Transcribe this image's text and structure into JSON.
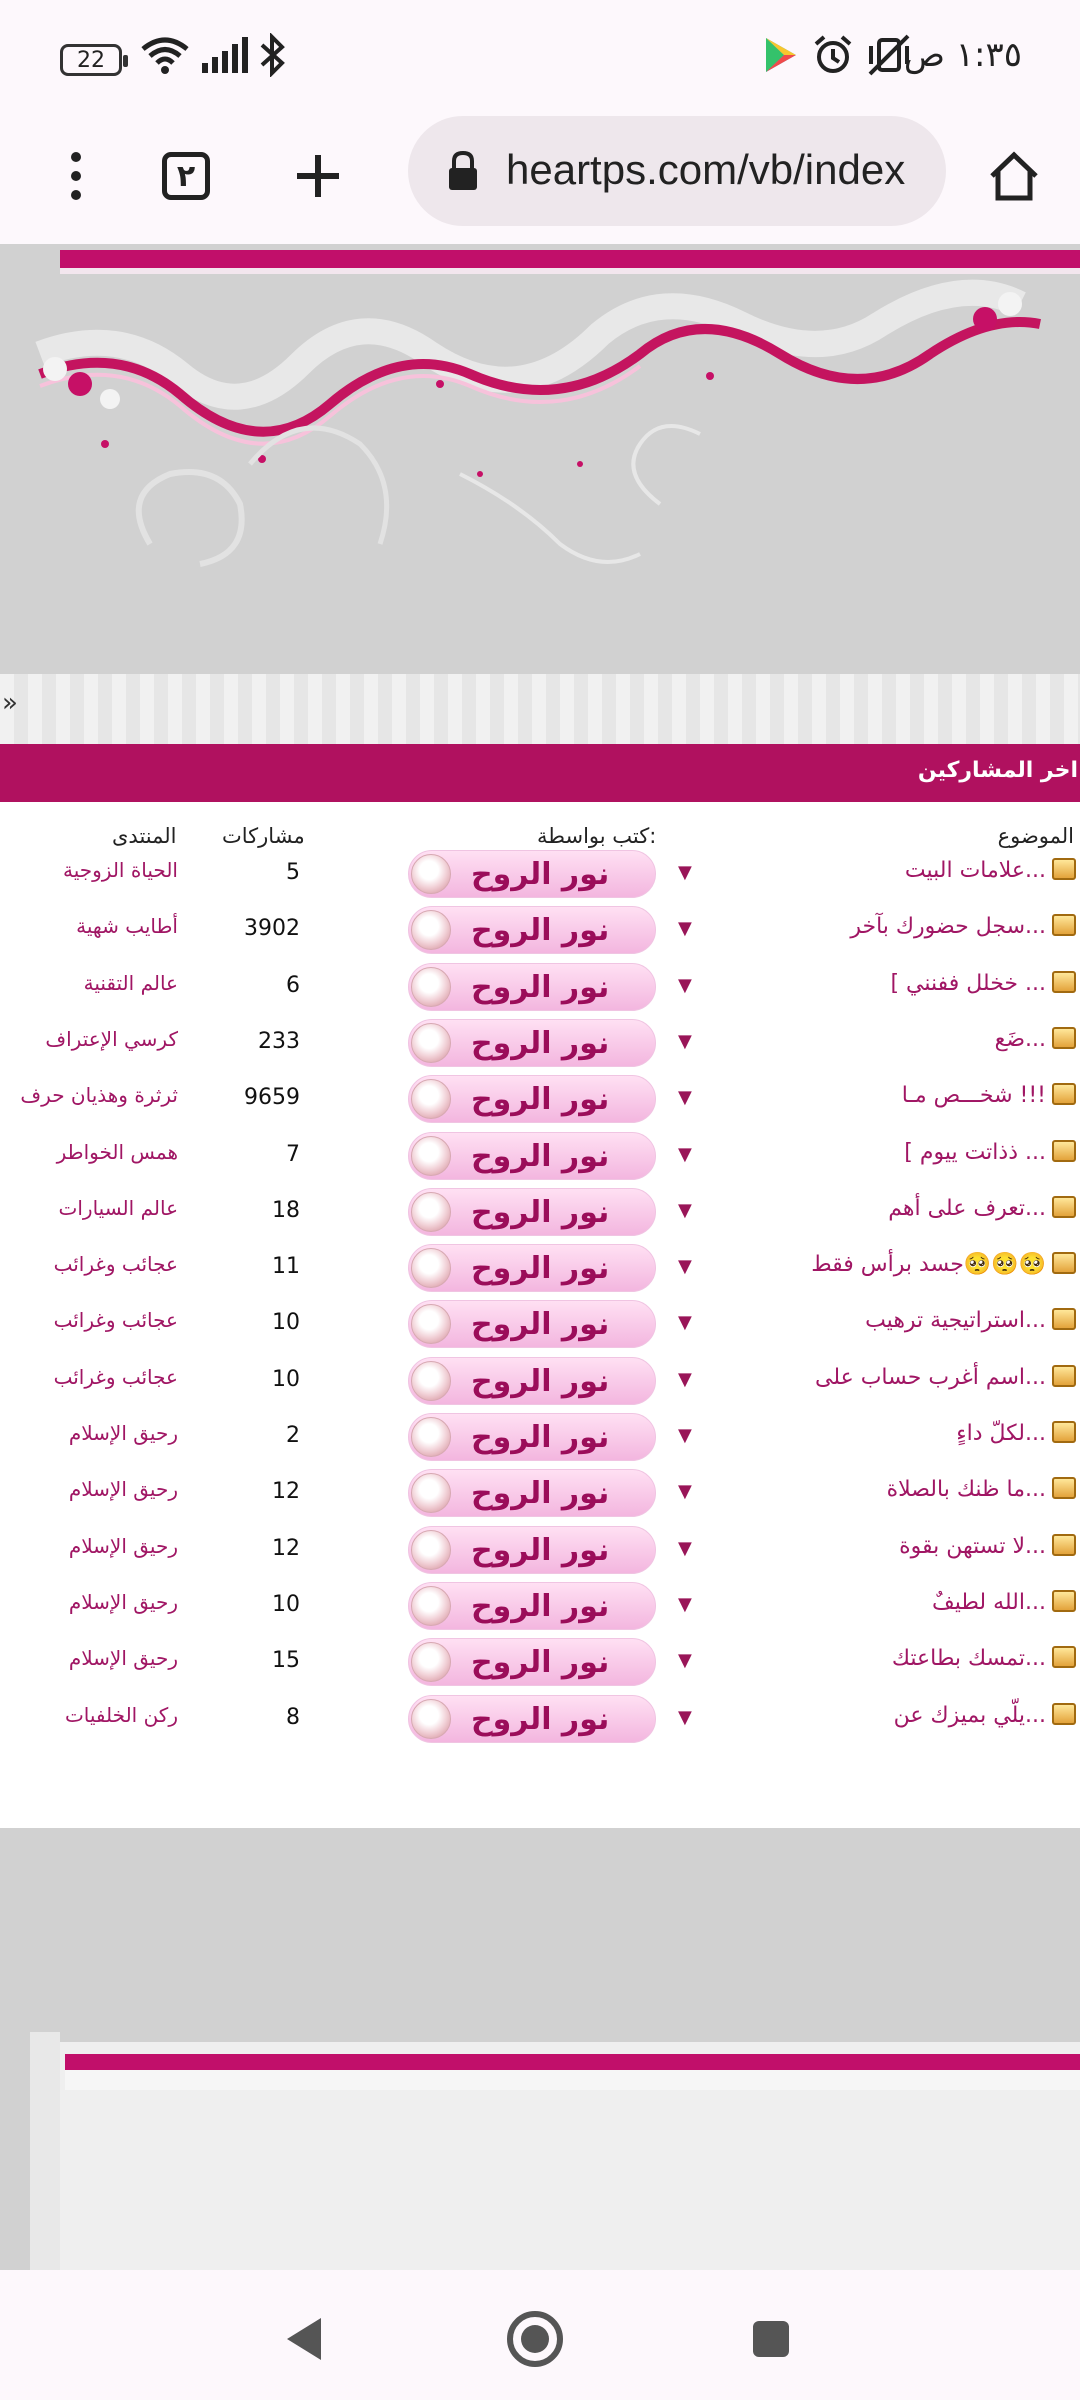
{
  "status_bar": {
    "time": "١:٣٥ ص",
    "battery": "22"
  },
  "browser": {
    "url": "heartps.com/vb/index",
    "tab_count": "٢"
  },
  "section": {
    "title": "اخر المشاركين"
  },
  "table": {
    "headers": {
      "topic": "الموضوع",
      "by": "كتب بواسطة:",
      "posts": "مشاركات",
      "forum": "المنتدى"
    },
    "rows": [
      {
        "topic": "علامات البيت...",
        "author": "نور الروح",
        "posts": "5",
        "forum": "الحياة الزوجية"
      },
      {
        "topic": "سجل حضورك بآخر...",
        "author": "نور الروح",
        "posts": "3902",
        "forum": "أطايب شهية"
      },
      {
        "topic": "[ خخلل ففنني ...",
        "author": "نور الروح",
        "posts": "6",
        "forum": "عالم التقنية"
      },
      {
        "topic": "ضَع...",
        "author": "نور الروح",
        "posts": "233",
        "forum": "كرسي الإعتراف"
      },
      {
        "topic": "شخـــص مـا !!!",
        "author": "نور الروح",
        "posts": "9659",
        "forum": "ثرثرة وهذيان حرف"
      },
      {
        "topic": "[ ذذاتت ييوم ...",
        "author": "نور الروح",
        "posts": "7",
        "forum": "همس الخواطر"
      },
      {
        "topic": "تعرف على أهم...",
        "author": "نور الروح",
        "posts": "18",
        "forum": "عالم السيارات"
      },
      {
        "topic": "جسد برأس فقط🥺🥺🥺",
        "author": "نور الروح",
        "posts": "11",
        "forum": "عجائب وغرائب"
      },
      {
        "topic": "استراتيجية ترهيب...",
        "author": "نور الروح",
        "posts": "10",
        "forum": "عجائب وغرائب"
      },
      {
        "topic": "اسم أغرب حساب على...",
        "author": "نور الروح",
        "posts": "10",
        "forum": "عجائب وغرائب"
      },
      {
        "topic": "لكلّ داءٍ...",
        "author": "نور الروح",
        "posts": "2",
        "forum": "رحيق الإسلام"
      },
      {
        "topic": "ما ظنك بالصلاة...",
        "author": "نور الروح",
        "posts": "12",
        "forum": "رحيق الإسلام"
      },
      {
        "topic": "لا تستهن بقوة...",
        "author": "نور الروح",
        "posts": "12",
        "forum": "رحيق الإسلام"
      },
      {
        "topic": "الله لطيفٌ...",
        "author": "نور الروح",
        "posts": "10",
        "forum": "رحيق الإسلام"
      },
      {
        "topic": "تمسك بطاعتك...",
        "author": "نور الروح",
        "posts": "15",
        "forum": "رحيق الإسلام"
      },
      {
        "topic": "يلّي بميزك عن...",
        "author": "نور الروح",
        "posts": "8",
        "forum": "ركن الخلفيات"
      }
    ]
  },
  "icons": {
    "battery": "battery-icon",
    "wifi": "wifi-icon",
    "signal": "signal-icon",
    "bluetooth": "bluetooth-icon",
    "play_store": "play-store-icon",
    "alarm": "alarm-icon",
    "mute": "vibrate-off-icon",
    "menu": "more-vertical-icon",
    "new_tab": "plus-icon",
    "lock": "lock-icon",
    "home": "home-icon",
    "back": "back-icon",
    "recents": "recents-icon"
  },
  "colors": {
    "accent": "#b0115f",
    "link": "#a01664",
    "banner_gray": "#d1d1d1"
  }
}
